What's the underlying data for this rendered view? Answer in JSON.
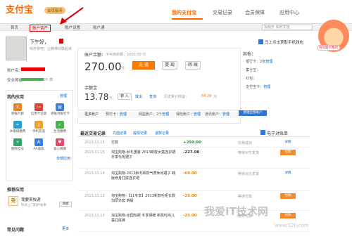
{
  "brand": {
    "logo": "支付宝",
    "sub_badge": "会员服务"
  },
  "nav": {
    "mine": "我的支付宝",
    "trade": "交易记录",
    "security": "会员保障",
    "apps": "应用中心"
  },
  "subtabs": {
    "home": "首页",
    "account": "账户资产",
    "settings": "账户设置",
    "tong": "账户通"
  },
  "search": {
    "placeholder": "找服务 如何充值"
  },
  "user": {
    "greeting": "下午好，",
    "greeting_sub": "喝杯茶吧，让精神抖擞起来",
    "account_label": "账户名：",
    "security_label": "安全等级：",
    "security_value": "高",
    "security_level": 0.85
  },
  "balance": {
    "label": "账户余额：",
    "available": "不可用余额：1000.00 元",
    "amount": "270.00",
    "unit": "元",
    "recharge": "充 值",
    "withdraw": "提 现",
    "transfer": "转 账"
  },
  "yuebao": {
    "label": "余额宝",
    "amount": "13.78",
    "unit": "元",
    "transfer_in": "转 入",
    "transfer_out": "转出",
    "query": "查询",
    "history_label": "历史累计收益：",
    "history_value": "54.29",
    "history_unit": "元"
  },
  "more_accounts": {
    "title": "更多账户",
    "items": [
      {
        "label": "预付卡：",
        "link": "管理"
      },
      {
        "label": "网盈账户：2个",
        "link": "管理"
      },
      {
        "label": "保险账户：",
        "link": "管理"
      },
      {
        "label": "通讯账户：",
        "link": "管理"
      }
    ],
    "manage_all": "管理全部账户"
  },
  "other": {
    "title": "其他：",
    "phone_link": "马上点击获取手机钱包",
    "rows": [
      {
        "label": "· 银行卡：2张",
        "link": "管理"
      },
      {
        "label": "· 集分宝：",
        "link": ""
      },
      {
        "label": "· 红包：",
        "link": ""
      },
      {
        "label": "· 支付宝卡：",
        "link": "管理"
      }
    ]
  },
  "mascot_label": "有问题点我吧",
  "apps": {
    "title": "我的应用",
    "manage": "管理",
    "items": [
      {
        "label": "转账付款",
        "color": "#e8832a",
        "icon": "transfer-icon",
        "glyph": "¥"
      },
      {
        "label": "信用卡还款",
        "color": "#d9453a",
        "icon": "credit-card-icon",
        "glyph": "▭"
      },
      {
        "label": "转账到银行卡",
        "color": "#3a7fd9",
        "icon": "bank-icon",
        "glyph": "▤"
      },
      {
        "label": "水电煤缴费",
        "color": "#2a9fd0",
        "icon": "utility-icon",
        "glyph": "≈"
      },
      {
        "label": "手机充值",
        "color": "#f0a030",
        "icon": "phone-icon",
        "glyph": "▯"
      },
      {
        "label": "生活缴费",
        "color": "#4caf50",
        "icon": "life-icon",
        "glyph": "✓"
      },
      {
        "label": "医院挂号",
        "color": "#2fa36b",
        "icon": "hospital-icon",
        "glyph": "+"
      },
      {
        "label": "AA收款",
        "color": "#3a7fd9",
        "icon": "aa-icon",
        "glyph": "A"
      },
      {
        "label": "爱心捐赠",
        "color": "#e04a6a",
        "icon": "heart-icon",
        "glyph": "♥"
      }
    ],
    "all_apps": "全部应用"
  },
  "recommend": {
    "title": "推荐应用",
    "name": "我要寄快递",
    "desc": "快递上门取件省事",
    "add": "添加"
  },
  "faq": {
    "title": "常见问题",
    "more": "更多"
  },
  "transactions": {
    "title": "最近交易记录",
    "filters": [
      "充值记录",
      "提现记录",
      "退款记录"
    ],
    "ebill": "电子对账单",
    "rows": [
      {
        "date": "2013.11.15",
        "desc": "付款",
        "amount": "+250.00",
        "color": "#2a8a2a",
        "status": "交易成功",
        "op": "详情",
        "op_style": "plain"
      },
      {
        "date": "2013.11.15",
        "desc": "淘宝购物-秋冬重装 2013新款女童连衣裙 冬季毛呢裙子",
        "amount": "-227.00",
        "color": "#333333",
        "status": "等待对方发货",
        "op": "付款",
        "op_style": "btn"
      },
      {
        "date": "2013.11.14",
        "desc": "淘宝购物-2013秋冬新款气质休闲裙子 韩版修身打底连衣裙",
        "amount": "-69.00",
        "color": "#e08a00",
        "status": "等待对方发货",
        "op": "详情",
        "op_style": "plain"
      },
      {
        "date": "2013.11.13",
        "desc": "淘宝购物-【11专享】2013新款毛呢长款 加厚外套 韩版",
        "amount": "-29.00",
        "color": "#e08a00",
        "status": "等待付款",
        "op": "付款",
        "op_style": "btn"
      },
      {
        "date": "2013.11.13",
        "desc": "淘宝购物-全国包邮 冬季保暖 新款时尚儿童打底裤",
        "amount": "-25.00",
        "color": "#e08a00",
        "status": "等待付款",
        "op": "付款",
        "op_style": "btn"
      }
    ]
  },
  "watermark": {
    "text": "我爱IT技术网",
    "url": "www.52ij.com"
  }
}
